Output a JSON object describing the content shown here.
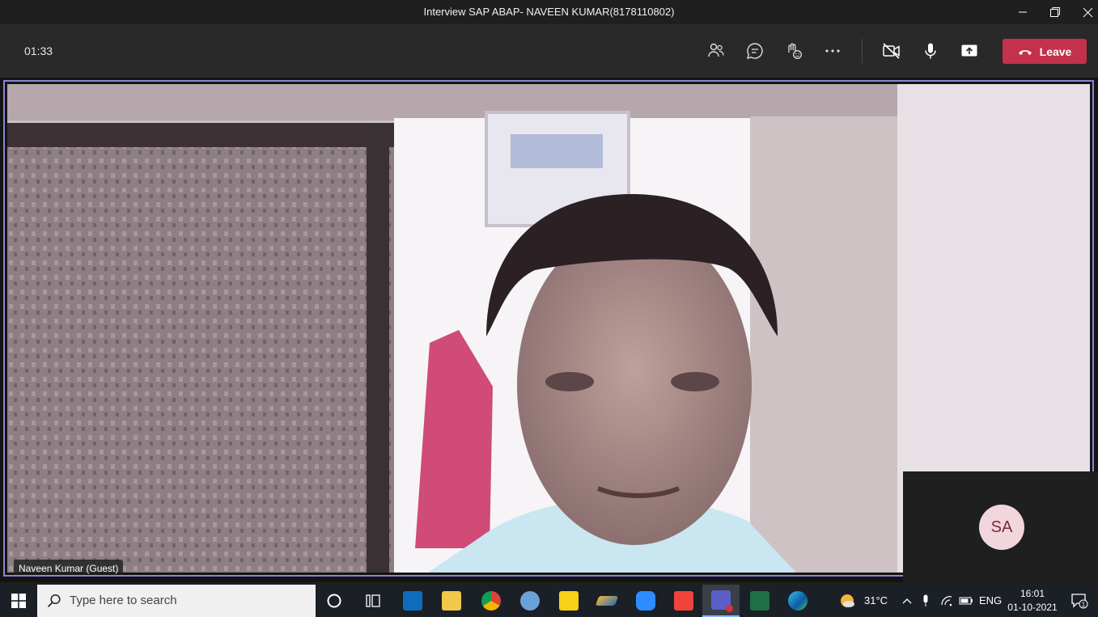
{
  "window": {
    "title": "Interview SAP ABAP- NAVEEN KUMAR(8178110802)"
  },
  "call": {
    "timer": "01:33",
    "leave_label": "Leave",
    "controls": [
      "people-icon",
      "chat-icon",
      "raise-hand-icon",
      "more-icon",
      "camera-off-icon",
      "microphone-icon",
      "share-screen-icon"
    ]
  },
  "participants": {
    "main": {
      "name": "Naveen Kumar (Guest)"
    },
    "tile": {
      "initials": "SA",
      "avatar_color": "#f1d6dd"
    }
  },
  "colors": {
    "leave": "#c4314b",
    "active_border": "#8a85d8",
    "toolbar": "#292929",
    "taskbar": "#1b1f26"
  },
  "taskbar": {
    "search_placeholder": "Type here to search",
    "apps": [
      "cortana-icon",
      "task-view-icon",
      "outlook-icon",
      "file-explorer-icon",
      "chrome-icon",
      "paint-icon",
      "sticky-notes-icon",
      "pen-app-icon",
      "zoom-icon",
      "anydesk-icon",
      "teams-icon",
      "excel-icon",
      "edge-icon"
    ],
    "weather": "31°C",
    "language": "ENG",
    "time": "16:01",
    "date": "01-10-2021",
    "notification_count": "1"
  }
}
